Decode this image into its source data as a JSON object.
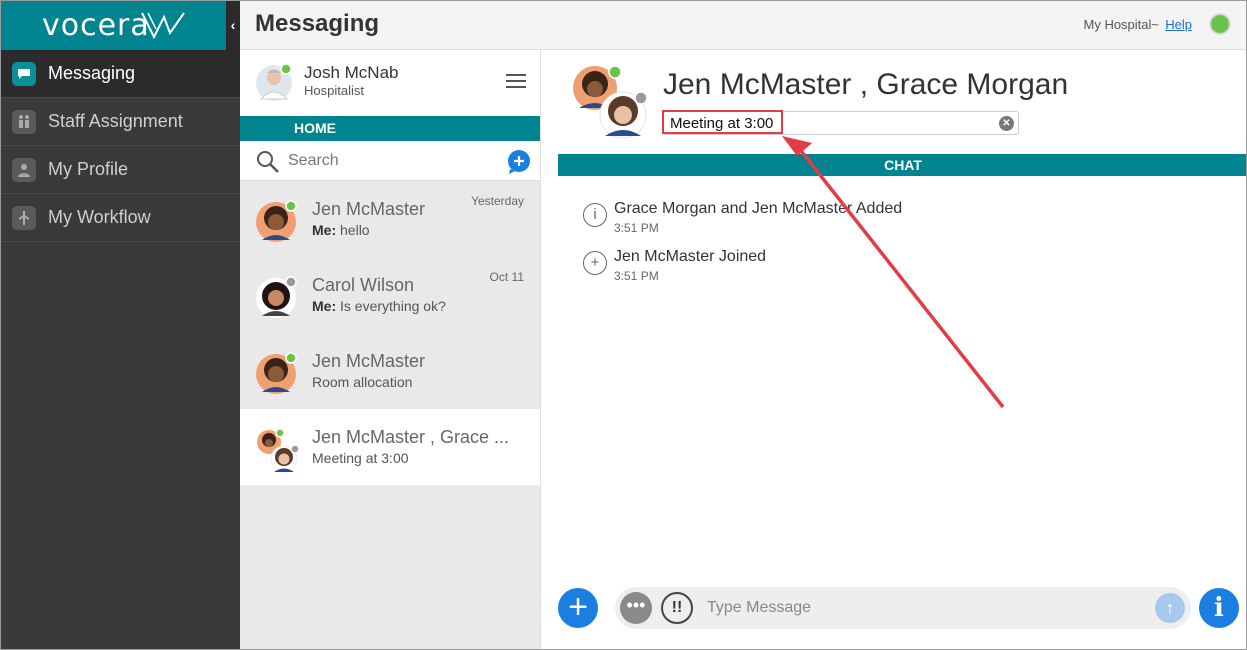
{
  "app": {
    "brand": "vocera",
    "collapse_glyph": "‹"
  },
  "sidebar": {
    "items": [
      {
        "label": "Messaging",
        "icon": "chat-bubble-icon",
        "active": true
      },
      {
        "label": "Staff Assignment",
        "icon": "staff-icon",
        "active": false
      },
      {
        "label": "My Profile",
        "icon": "profile-icon",
        "active": false
      },
      {
        "label": "My Workflow",
        "icon": "workflow-icon",
        "active": false
      }
    ]
  },
  "header": {
    "title": "Messaging",
    "hospital": "My Hospital~",
    "help": "Help",
    "status_color": "#6cc24a"
  },
  "user": {
    "name": "Josh McNab",
    "role": "Hospitalist"
  },
  "home_label": "HOME",
  "search": {
    "placeholder": "Search"
  },
  "conversations": [
    {
      "name": "Jen McMaster",
      "sender": "Me:",
      "preview": "hello",
      "date": "Yesterday",
      "presence": "online"
    },
    {
      "name": "Carol Wilson",
      "sender": "Me:",
      "preview": "Is everything ok?",
      "date": "Oct 11",
      "presence": "offline"
    },
    {
      "name": "Jen McMaster",
      "sender": "",
      "preview": "Room allocation",
      "date": "",
      "presence": "online"
    },
    {
      "name": "Jen McMaster , Grace ...",
      "sender": "",
      "preview": "Meeting at 3:00",
      "date": "",
      "presence": "group"
    }
  ],
  "chat": {
    "title": "Jen McMaster , Grace Morgan",
    "topic": "Meeting at 3:00",
    "section_label": "CHAT",
    "events": [
      {
        "text": "Grace Morgan and Jen McMaster Added",
        "time": "3:51 PM",
        "icon": "i"
      },
      {
        "text": "Jen McMaster Joined",
        "time": "3:51 PM",
        "icon": "+"
      }
    ],
    "composer_placeholder": "Type Message"
  },
  "colors": {
    "teal": "#00848f",
    "sidebar": "#3a3a3a",
    "accent_blue": "#1a7fe0",
    "annotation_red": "#e33c46"
  }
}
